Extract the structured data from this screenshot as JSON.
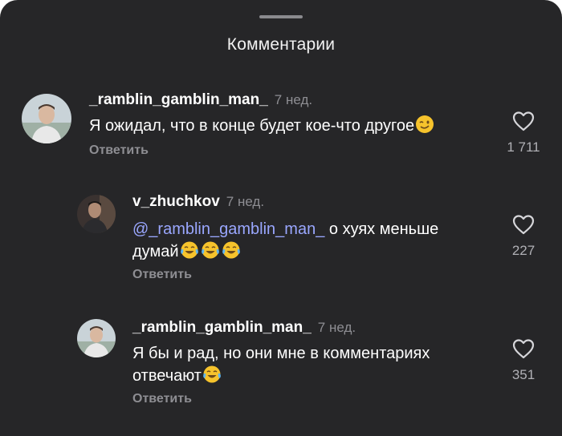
{
  "sheet": {
    "title": "Комментарии"
  },
  "comments": [
    {
      "author": "_ramblin_gamblin_man_",
      "time": "7 нед.",
      "text": "Я ожидал, что в конце будет кое-что другое",
      "emoji": [
        "wink-emoji"
      ],
      "reply_label": "Ответить",
      "likes": "1 711"
    },
    {
      "author": "v_zhuchkov",
      "time": "7 нед.",
      "mention": "@_ramblin_gamblin_man_",
      "text": " о хуях меньше думай",
      "emoji": [
        "tears-of-joy-emoji",
        "tears-of-joy-emoji",
        "tears-of-joy-emoji"
      ],
      "reply_label": "Ответить",
      "likes": "227"
    },
    {
      "author": "_ramblin_gamblin_man_",
      "time": "7 нед.",
      "text": "Я бы и рад, но они мне в комментариях отвечают",
      "emoji": [
        "tears-of-joy-emoji"
      ],
      "reply_label": "Ответить",
      "likes": "351"
    }
  ],
  "icons": {
    "like": "heart-outline-icon"
  },
  "colors": {
    "background": "#262628",
    "mention": "#9aa7ff",
    "muted": "#8e8e93"
  }
}
